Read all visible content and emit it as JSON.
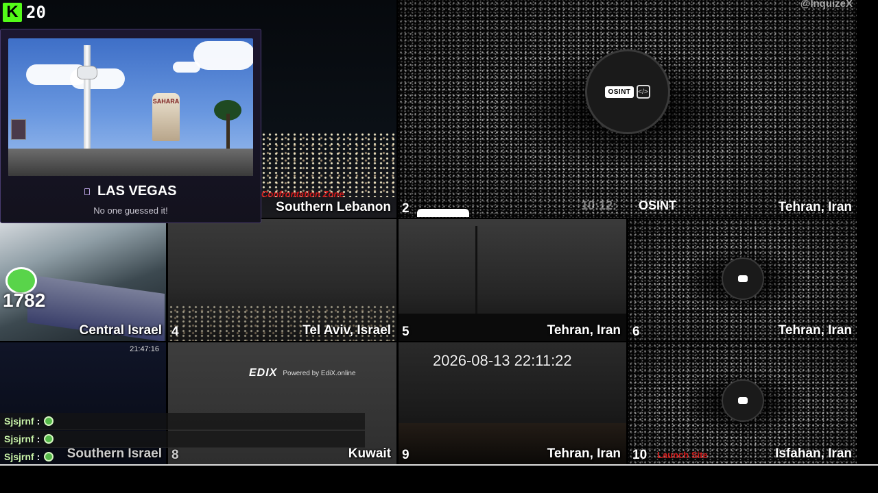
{
  "counter": {
    "badge": "K",
    "value": "20"
  },
  "watermark": "@InquizeX",
  "popup": {
    "location": "LAS VEGAS",
    "status": "No one guessed it!",
    "sign_text": "SAHARA"
  },
  "osint_logo": "OSINT",
  "overlay_user_count": "1782",
  "tiles": [
    {
      "id": "t1",
      "label": "Southern Lebanon",
      "tag": "Confrontation Zone",
      "number": "2"
    },
    {
      "id": "t2",
      "label": "Tehran, Iran",
      "timestamp_partial": "10:12:",
      "number": ""
    },
    {
      "id": "t3",
      "label": "Central Israel",
      "number": "4"
    },
    {
      "id": "t4",
      "label": "Tel Aviv, Israel",
      "number": "5"
    },
    {
      "id": "t5",
      "label": "Tehran, Iran",
      "number": "6"
    },
    {
      "id": "t6",
      "label": "Tehran, Iran",
      "number": ""
    },
    {
      "id": "t7",
      "label": "Southern Israel",
      "timestamp": "21:47:16",
      "number": "8"
    },
    {
      "id": "t8",
      "label": "Kuwait",
      "number": "9",
      "ad_brand": "EDIX",
      "ad_text": "Powered by EdiX.online"
    },
    {
      "id": "t9",
      "label": "Tehran, Iran",
      "timestamp": "2026-08-13 22:11:22",
      "number": "10"
    },
    {
      "id": "t10",
      "label": "Isfahan, Iran",
      "tag": "Launch Site",
      "number": ""
    }
  ],
  "chat": [
    {
      "user": "Sjsjrnf",
      "separator": ":"
    },
    {
      "user": "Sjsjrnf",
      "separator": ":"
    },
    {
      "user": "Sjsjrnf",
      "separator": ":"
    }
  ],
  "colors": {
    "popup_accent": "#4a3d72",
    "tag_red": "#d11a1a",
    "chat_name": "#c8f2a8"
  }
}
